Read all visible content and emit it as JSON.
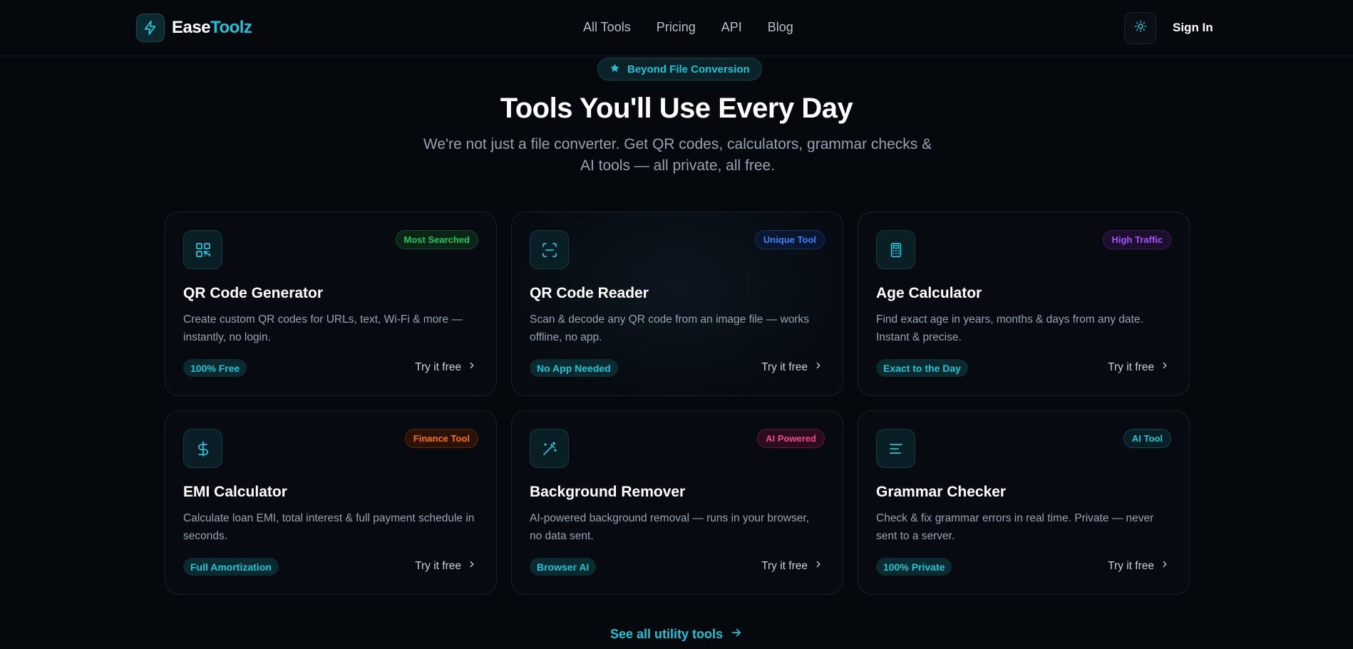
{
  "brand": {
    "name_a": "Ease",
    "name_b": "Toolz",
    "accent": "#22c3d6",
    "icon": "bolt-icon"
  },
  "nav": [
    {
      "label": "All Tools"
    },
    {
      "label": "Pricing"
    },
    {
      "label": "API"
    },
    {
      "label": "Blog"
    }
  ],
  "header": {
    "theme_icon": "sun-icon",
    "signin_label": "Sign In"
  },
  "hero": {
    "pill_icon": "star-icon",
    "pill_label": "Beyond File Conversion",
    "title": "Tools You'll Use Every Day",
    "subtitle": "We're not just a file converter. Get QR codes, calculators, grammar checks & AI tools — all private, all free."
  },
  "cards": [
    {
      "icon": "qr-code-icon",
      "badge": "Most Searched",
      "badge_color": "#22c55e",
      "title": "QR Code Generator",
      "desc": "Create custom QR codes for URLs, text, Wi-Fi & more — instantly, no login.",
      "tag": "100% Free",
      "cta": "Try it free"
    },
    {
      "icon": "scan-icon",
      "badge": "Unique Tool",
      "badge_color": "#3b82f6",
      "title": "QR Code Reader",
      "desc": "Scan & decode any QR code from an image file — works offline, no app.",
      "tag": "No App Needed",
      "cta": "Try it free"
    },
    {
      "icon": "calculator-icon",
      "badge": "High Traffic",
      "badge_color": "#a855f7",
      "title": "Age Calculator",
      "desc": "Find exact age in years, months & days from any date. Instant & precise.",
      "tag": "Exact to the Day",
      "cta": "Try it free"
    },
    {
      "icon": "dollar-icon",
      "badge": "Finance Tool",
      "badge_color": "#f97316",
      "title": "EMI Calculator",
      "desc": "Calculate loan EMI, total interest & full payment schedule in seconds.",
      "tag": "Full Amortization",
      "cta": "Try it free"
    },
    {
      "icon": "magic-wand-icon",
      "badge": "AI Powered",
      "badge_color": "#ec4899",
      "title": "Background Remover",
      "desc": "AI-powered background removal — runs in your browser, no data sent.",
      "tag": "Browser AI",
      "cta": "Try it free"
    },
    {
      "icon": "text-align-icon",
      "badge": "AI Tool",
      "badge_color": "#22c3d6",
      "title": "Grammar Checker",
      "desc": "Check & fix grammar errors in real time. Private — never sent to a server.",
      "tag": "100% Private",
      "cta": "Try it free"
    }
  ],
  "footer_link": {
    "label": "See all utility tools",
    "icon": "arrow-right-icon"
  }
}
